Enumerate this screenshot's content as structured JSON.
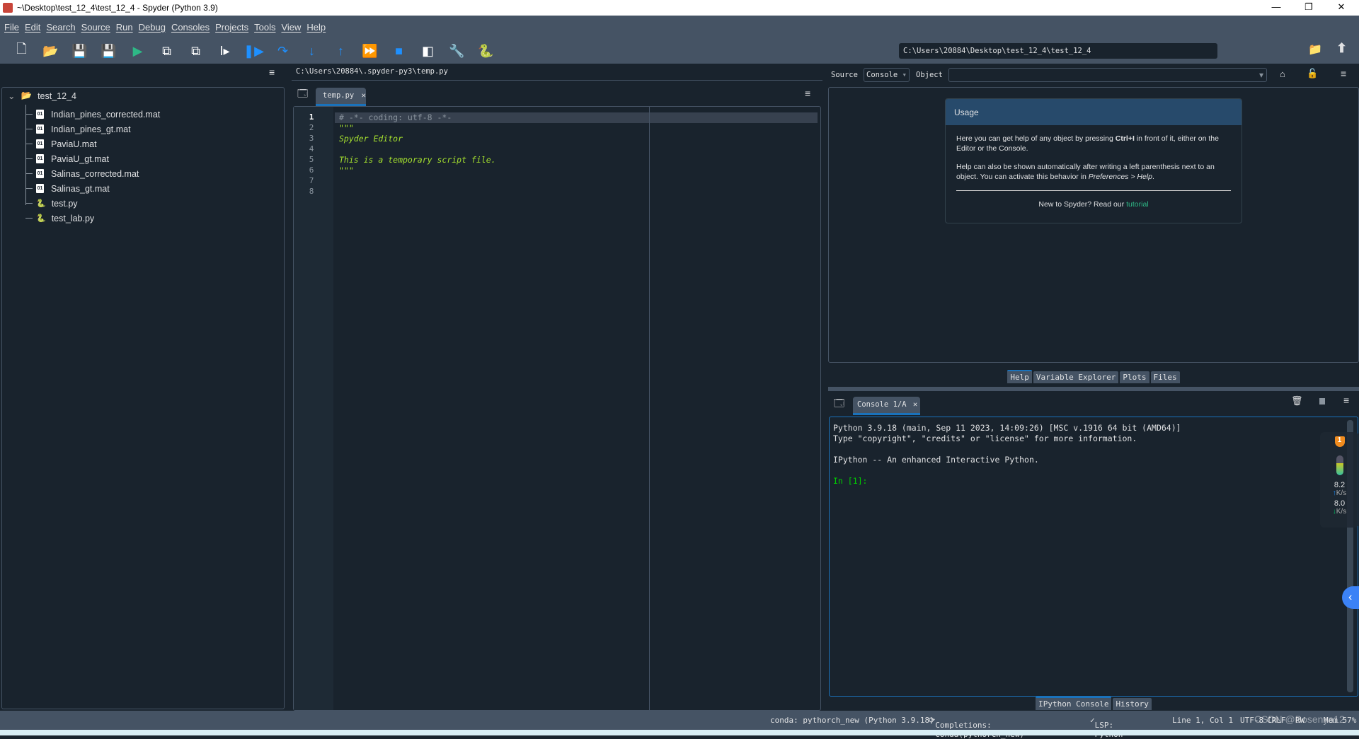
{
  "window": {
    "title": "~\\Desktop\\test_12_4\\test_12_4 - Spyder (Python 3.9)",
    "minimize": "—",
    "maximize": "❐",
    "close": "✕"
  },
  "menu": [
    "File",
    "Edit",
    "Search",
    "Source",
    "Run",
    "Debug",
    "Consoles",
    "Projects",
    "Tools",
    "View",
    "Help"
  ],
  "toolbar": {
    "icons": [
      "new-file",
      "open-file",
      "save",
      "save-all",
      "run",
      "run-cell",
      "run-cell-advance",
      "run-selection",
      "debug",
      "step-over",
      "step-into",
      "step-return",
      "continue",
      "stop",
      "maximize-pane",
      "preferences",
      "pythonpath-manager"
    ],
    "working_dir": "C:\\Users\\20884\\Desktop\\test_12_4\\test_12_4"
  },
  "files": {
    "root": "test_12_4",
    "items": [
      {
        "name": "Indian_pines_corrected.mat",
        "type": "mat"
      },
      {
        "name": "Indian_pines_gt.mat",
        "type": "mat"
      },
      {
        "name": "PaviaU.mat",
        "type": "mat"
      },
      {
        "name": "PaviaU_gt.mat",
        "type": "mat"
      },
      {
        "name": "Salinas_corrected.mat",
        "type": "mat"
      },
      {
        "name": "Salinas_gt.mat",
        "type": "mat"
      },
      {
        "name": "test.py",
        "type": "py"
      },
      {
        "name": "test_lab.py",
        "type": "py"
      }
    ]
  },
  "editor": {
    "path": "C:\\Users\\20884\\.spyder-py3\\temp.py",
    "tab": "temp.py",
    "lines": [
      "# -*- coding: utf-8 -*-",
      "\"\"\"",
      "Spyder Editor",
      "",
      "This is a temporary script file.",
      "\"\"\"",
      "",
      ""
    ],
    "line_numbers": [
      "1",
      "2",
      "3",
      "4",
      "5",
      "6",
      "7",
      "8"
    ]
  },
  "help": {
    "source_label": "Source",
    "source_value": "Console",
    "object_label": "Object",
    "object_value": "",
    "usage_title": "Usage",
    "p1_a": "Here you can get help of any object by pressing ",
    "p1_b": "Ctrl+I",
    "p1_c": " in front of it, either on the Editor or the Console.",
    "p2_a": "Help can also be shown automatically after writing a left parenthesis next to an object. You can activate this behavior in ",
    "p2_b": "Preferences > Help",
    "p2_c": ".",
    "new_a": "New to Spyder? Read our ",
    "new_link": "tutorial",
    "tabs": [
      "Help",
      "Variable Explorer",
      "Plots",
      "Files"
    ],
    "active_tab": "Help"
  },
  "console": {
    "tab": "Console 1/A",
    "lines": [
      "Python 3.9.18 (main, Sep 11 2023, 14:09:26) [MSC v.1916 64 bit (AMD64)]",
      "Type \"copyright\", \"credits\" or \"license\" for more information.",
      "",
      "IPython  -- An enhanced Interactive Python.",
      ""
    ],
    "prompt": "In [1]:",
    "tabs": [
      "IPython Console",
      "History"
    ],
    "active_tab": "IPython Console"
  },
  "overlay": {
    "badge": "1",
    "up_speed": "8.2",
    "up_unit": "K/s",
    "down_speed": "8.0",
    "down_unit": "K/s"
  },
  "status": {
    "conda": "conda: pythorch_new (Python 3.9.18)",
    "completions": "Completions: conda(pythorch_new)",
    "lsp": "LSP: Python",
    "position": "Line 1, Col 1",
    "encoding": "UTF-8",
    "eol": "CRLF",
    "rw": "RW",
    "mem": "Mem 57%",
    "watermark": "CSDN @Bosenya12"
  },
  "colors": {
    "bg": "#19232d",
    "chrome": "#455364",
    "accent": "#1a72bb",
    "string": "#a6e22e",
    "prompt": "#00d000",
    "link": "#2eb886"
  }
}
